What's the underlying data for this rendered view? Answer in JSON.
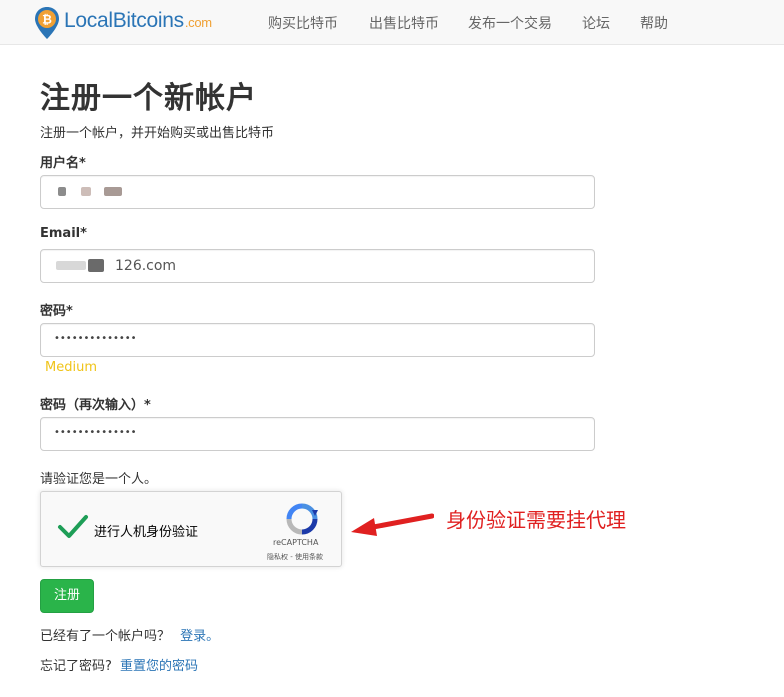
{
  "header": {
    "brand_name": "LocalBitcoins",
    "brand_domain": ".com",
    "nav": [
      {
        "label": "购买比特币"
      },
      {
        "label": "出售比特币"
      },
      {
        "label": "发布一个交易"
      },
      {
        "label": "论坛"
      },
      {
        "label": "帮助"
      }
    ]
  },
  "form": {
    "title": "注册一个新帐户",
    "subtitle": "注册一个帐户，并开始购买或出售比特币",
    "username_label": "用户名*",
    "email_label": "Email*",
    "email_value_visible": "126.com",
    "password_label": "密码*",
    "password_mask": "••••••••••••••",
    "password_strength": "Medium",
    "password2_label": "密码（再次输入）*",
    "password2_mask": "••••••••••••••",
    "human_label": "请验证您是一个人。",
    "captcha": {
      "checkbox_label": "进行人机身份验证",
      "brand": "reCAPTCHA",
      "links": "隐私权 - 使用条款"
    },
    "submit_label": "注册",
    "login_prompt": "已经有了一个帐户吗？",
    "login_link": "登录。",
    "reset_prompt": "忘记了密码?",
    "reset_link": "重置您的密码"
  },
  "annotation": {
    "text": "身份验证需要挂代理"
  },
  "colors": {
    "brand_blue": "#2b75b6",
    "brand_orange": "#f0a033",
    "success_green": "#2ab44a",
    "strength_yellow": "#f0c419",
    "annotation_red": "#e02020"
  }
}
